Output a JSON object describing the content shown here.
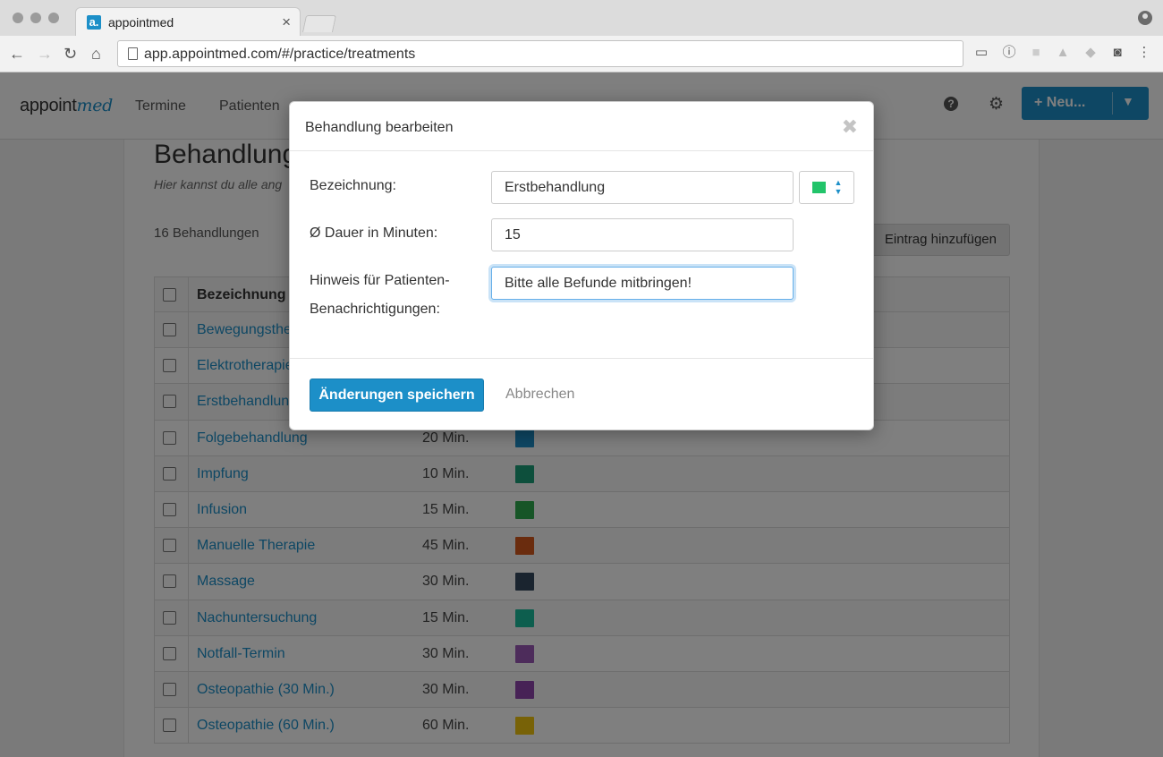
{
  "browser": {
    "tab_title": "appointmed",
    "favicon_letter": "a.",
    "url": "app.appointmed.com/#/practice/treatments"
  },
  "app": {
    "logo_main": "appoint",
    "logo_accent": "med",
    "nav": [
      "Termine",
      "Patienten"
    ],
    "help_icon": "?",
    "new_button": "+ Neu...",
    "brand_color": "#1c8fc8"
  },
  "page": {
    "title": "Behandlung",
    "subtitle": "Hier kannst du alle ang",
    "count": "16 Behandlungen",
    "add_button": "Eintrag hinzufügen",
    "table": {
      "header_name": "Bezeichnung",
      "rows": [
        {
          "name": "Bewegungsthe",
          "duration": "",
          "color": ""
        },
        {
          "name": "Elektrotherapie",
          "duration": "",
          "color": ""
        },
        {
          "name": "Erstbehandlun",
          "duration": "",
          "color": ""
        },
        {
          "name": "Folgebehandlung",
          "duration": "20 Min.",
          "color": "#1c8fc8"
        },
        {
          "name": "Impfung",
          "duration": "10 Min.",
          "color": "#1a9e78"
        },
        {
          "name": "Infusion",
          "duration": "15 Min.",
          "color": "#2eab4e"
        },
        {
          "name": "Manuelle Therapie",
          "duration": "45 Min.",
          "color": "#d4581c"
        },
        {
          "name": "Massage",
          "duration": "30 Min.",
          "color": "#34495e"
        },
        {
          "name": "Nachuntersuchung",
          "duration": "15 Min.",
          "color": "#1abc9c"
        },
        {
          "name": "Notfall-Termin",
          "duration": "30 Min.",
          "color": "#9b59b6"
        },
        {
          "name": "Osteopathie (30 Min.)",
          "duration": "30 Min.",
          "color": "#8e44ad"
        },
        {
          "name": "Osteopathie (60 Min.)",
          "duration": "60 Min.",
          "color": "#f1c40f"
        }
      ]
    }
  },
  "modal": {
    "title": "Behandlung bearbeiten",
    "close_icon": "✖",
    "fields": {
      "name_label": "Bezeichnung:",
      "name_value": "Erstbehandlung",
      "duration_label": "Ø Dauer in Minuten:",
      "duration_value": "15",
      "hint_label_1": "Hinweis für Patienten-",
      "hint_label_2": "Benachrichtigungen:",
      "hint_value": "Bitte alle Befunde mitbringen!"
    },
    "selected_color": "#22c46a",
    "save_button": "Änderungen speichern",
    "cancel_link": "Abbrechen"
  }
}
